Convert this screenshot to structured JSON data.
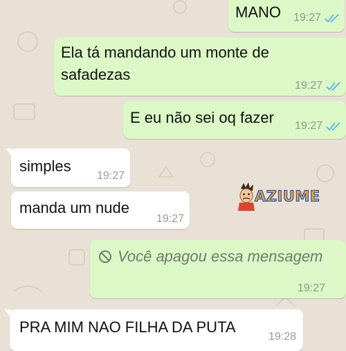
{
  "messages": [
    {
      "id": "m1",
      "direction": "outgoing",
      "text": "MANO",
      "time": "19:27",
      "read": true
    },
    {
      "id": "m2",
      "direction": "outgoing",
      "lines": [
        "Ela tá mandando um monte de",
        "safadezas"
      ],
      "time": "19:27",
      "read": true
    },
    {
      "id": "m3",
      "direction": "outgoing",
      "text": "E eu não sei oq fazer",
      "time": "19:27",
      "read": true
    },
    {
      "id": "m4",
      "direction": "incoming",
      "text": "simples",
      "time": "19:27"
    },
    {
      "id": "m5",
      "direction": "incoming",
      "text": "manda um nude",
      "time": "19:27"
    },
    {
      "id": "m6",
      "direction": "outgoing",
      "text": "Você apagou essa mensagem",
      "time": "19:27",
      "deleted": true,
      "icon": "ban-icon"
    },
    {
      "id": "m7",
      "direction": "incoming",
      "text": "PRA MIM NAO FILHA DA PUTA",
      "time": "19:28"
    }
  ],
  "watermark": {
    "text": "AZIUME"
  },
  "colors": {
    "background": "#e9e1d6",
    "outgoing_bubble": "#dcf8c6",
    "incoming_bubble": "#ffffff",
    "read_ticks": "#4fb6ec",
    "watermark_fill": "#f5a623",
    "watermark_stroke": "#1e56c8"
  }
}
